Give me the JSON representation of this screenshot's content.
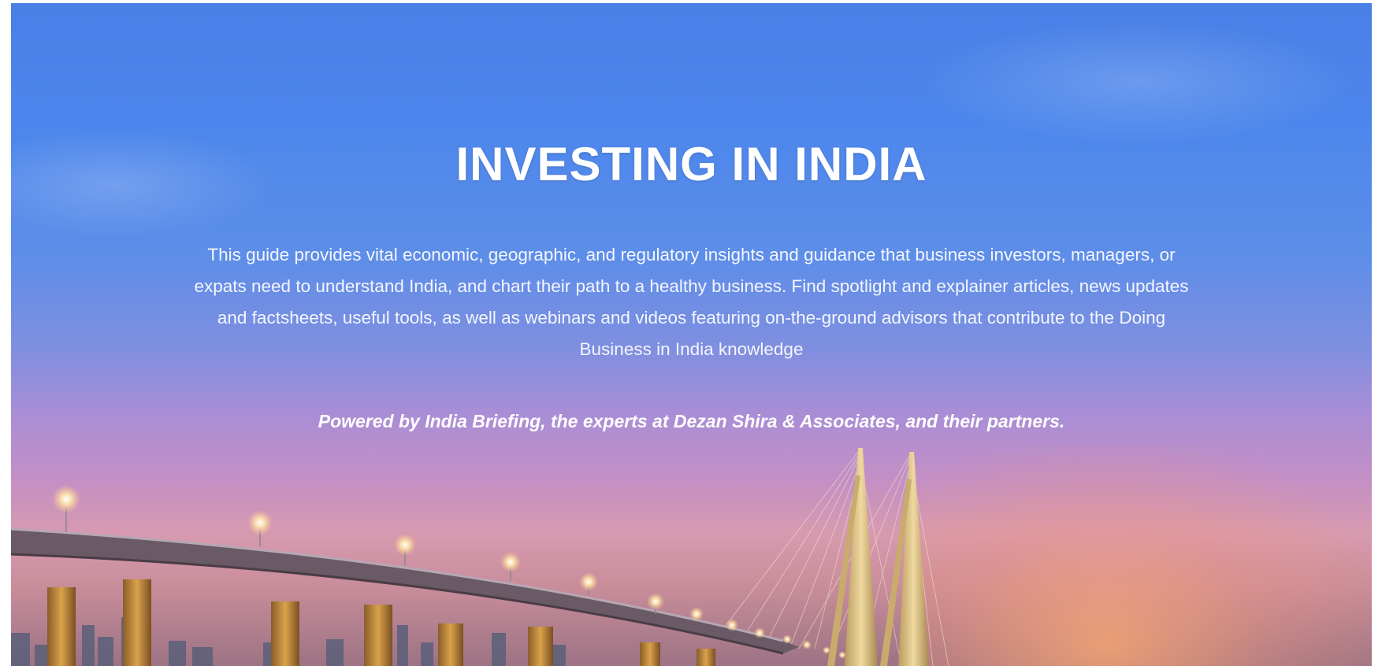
{
  "hero": {
    "title": "INVESTING IN INDIA",
    "description": "This guide provides vital economic, geographic, and regulatory insights and guidance that business investors, managers, or expats need to understand India, and chart their path to a healthy business. Find spotlight and explainer articles, news updates and factsheets, useful tools, as well as webinars and videos featuring on-the-ground advisors that contribute to the Doing Business in India knowledge",
    "powered_by": "Powered by India Briefing, the experts at Dezan Shira & Associates, and their partners."
  }
}
